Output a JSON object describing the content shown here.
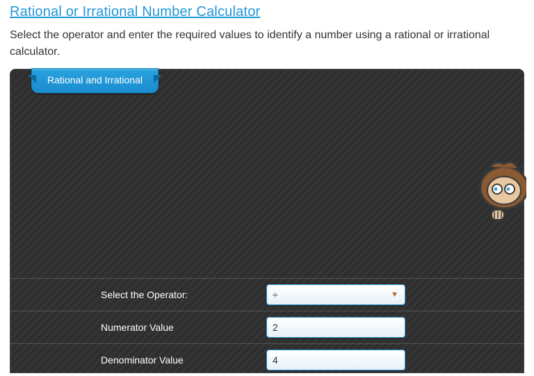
{
  "heading": "Rational or Irrational Number Calculator",
  "subheading": "Select the operator and enter the required values to identify a number using a rational or irrational calculator.",
  "tab_label": "Rational and Irrational",
  "form": {
    "operator": {
      "label": "Select the Operator:",
      "value": "÷"
    },
    "numerator": {
      "label": "Numerator Value",
      "value": "2"
    },
    "denominator": {
      "label": "Denominator Value",
      "value": "4"
    }
  },
  "mascot_alt": "monkey-peek-icon"
}
